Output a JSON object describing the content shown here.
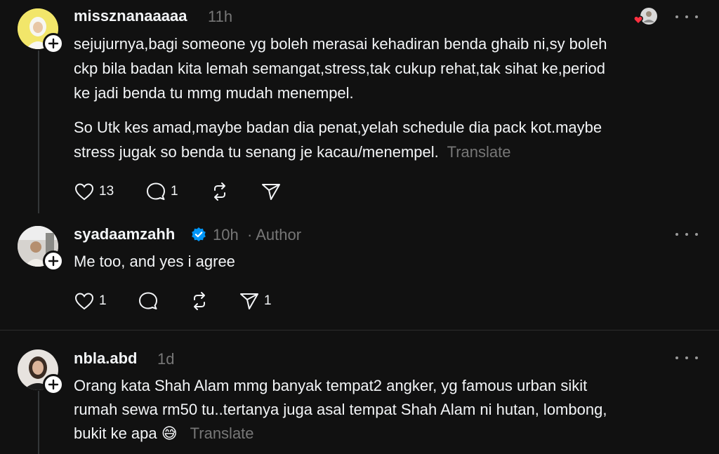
{
  "posts": [
    {
      "username": "missznanaaaaa",
      "time": "11h",
      "paragraphs": [
        [
          "sejujurnya,bagi someone yg boleh merasai kehadiran benda ghaib ni,sy boleh",
          "ckp bila badan kita lemah semangat,stress,tak cukup rehat,tak sihat ke,period",
          "ke jadi benda tu mmg mudah menempel."
        ],
        [
          "So Utk kes amad,maybe badan dia penat,yelah schedule dia pack kot.maybe",
          "stress jugak so benda tu senang je kacau/menempel."
        ]
      ],
      "translate": "Translate",
      "likes": "13",
      "replies": "1",
      "reposts": "",
      "shares": ""
    },
    {
      "username": "syadaamzahh",
      "time": "10h",
      "author_label": "· Author",
      "text": "Me too, and yes i agree",
      "likes": "1",
      "replies": "",
      "reposts": "",
      "shares": "1"
    },
    {
      "username": "nbla.abd",
      "time": "1d",
      "lines": [
        "Orang kata Shah Alam mmg banyak tempat2 angker, yg famous urban sikit",
        "rumah sewa rm50 tu..tertanya juga asal tempat Shah Alam ni hutan, lombong,",
        "bukit ke apa 😅"
      ],
      "translate": "Translate"
    }
  ],
  "colors": {
    "background": "#111111",
    "text": "#f3f5f7",
    "muted": "#777777",
    "verified": "#0095f6",
    "heart": "#ff3040"
  }
}
